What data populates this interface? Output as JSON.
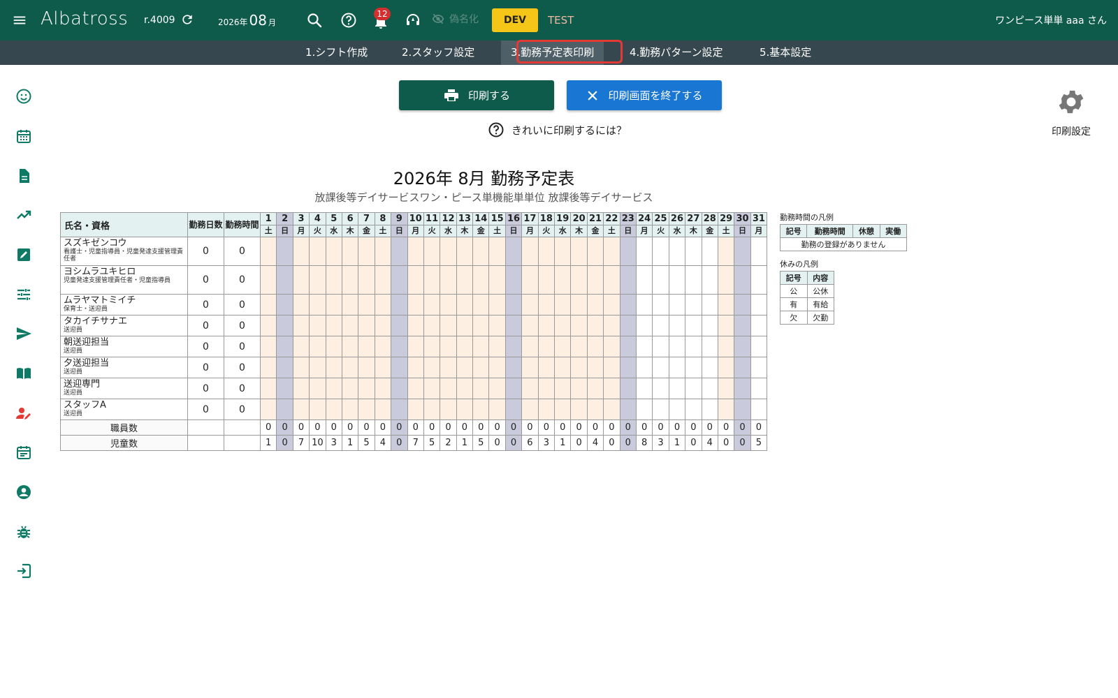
{
  "header": {
    "logo": "Albatross",
    "revision": "r.4009",
    "year_label": "2026年",
    "month": "08",
    "month_unit": "月",
    "notification_count": "12",
    "pseudonym_label": "偽名化",
    "dev_label": "DEV",
    "test_label": "TEST",
    "user": "ワンピース単単 aaa さん"
  },
  "tabs": [
    {
      "label": "1.シフト作成"
    },
    {
      "label": "2.スタッフ設定"
    },
    {
      "label": "3.勤務予定表印刷"
    },
    {
      "label": "4.勤務パターン設定"
    },
    {
      "label": "5.基本設定"
    }
  ],
  "actions": {
    "print": "印刷する",
    "close": "印刷画面を終了する",
    "help": "きれいに印刷するには？",
    "print_settings": "印刷設定"
  },
  "document": {
    "title": "2026年 8月 勤務予定表",
    "subtitle": "放課後等デイサービスワン・ピース単機能単単位 放課後等デイサービス"
  },
  "schedule": {
    "col_name": "氏名・資格",
    "col_days": "勤務日数",
    "col_hours": "勤務時間",
    "days": [
      "1",
      "2",
      "3",
      "4",
      "5",
      "6",
      "7",
      "8",
      "9",
      "10",
      "11",
      "12",
      "13",
      "14",
      "15",
      "16",
      "17",
      "18",
      "19",
      "20",
      "21",
      "22",
      "23",
      "24",
      "25",
      "26",
      "27",
      "28",
      "29",
      "30",
      "31"
    ],
    "weekdays": [
      "土",
      "日",
      "月",
      "火",
      "水",
      "木",
      "金",
      "土",
      "日",
      "月",
      "火",
      "水",
      "木",
      "金",
      "土",
      "日",
      "月",
      "火",
      "水",
      "木",
      "金",
      "土",
      "日",
      "月",
      "火",
      "水",
      "木",
      "金",
      "土",
      "日",
      "月"
    ],
    "staff": [
      {
        "name": "スズキゼンコウ",
        "qual": "看護士・児童指導員・児童発達支援管理責任者",
        "days": "0",
        "hours": "0"
      },
      {
        "name": "ヨシムラユキヒロ",
        "qual": "児童発達支援管理責任者・児童指導員",
        "days": "0",
        "hours": "0"
      },
      {
        "name": "ムラヤマトミイチ",
        "qual": "保育士・送迎員",
        "days": "0",
        "hours": "0"
      },
      {
        "name": "タカイチサナエ",
        "qual": "送迎員",
        "days": "0",
        "hours": "0"
      },
      {
        "name": "朝送迎担当",
        "qual": "送迎員",
        "days": "0",
        "hours": "0"
      },
      {
        "name": "夕送迎担当",
        "qual": "送迎員",
        "days": "0",
        "hours": "0"
      },
      {
        "name": "送迎専門",
        "qual": "送迎員",
        "days": "0",
        "hours": "0"
      },
      {
        "name": "スタッフA",
        "qual": "送迎員",
        "days": "0",
        "hours": "0"
      }
    ],
    "staff_count_label": "職員数",
    "staff_counts": [
      "0",
      "0",
      "0",
      "0",
      "0",
      "0",
      "0",
      "0",
      "0",
      "0",
      "0",
      "0",
      "0",
      "0",
      "0",
      "0",
      "0",
      "0",
      "0",
      "0",
      "0",
      "0",
      "0",
      "0",
      "0",
      "0",
      "0",
      "0",
      "0",
      "0",
      "0"
    ],
    "child_count_label": "児童数",
    "child_counts": [
      "1",
      "0",
      "7",
      "10",
      "3",
      "1",
      "5",
      "4",
      "0",
      "7",
      "5",
      "2",
      "1",
      "5",
      "0",
      "0",
      "6",
      "3",
      "1",
      "0",
      "4",
      "0",
      "0",
      "8",
      "3",
      "1",
      "0",
      "4",
      "0",
      "0",
      "5"
    ]
  },
  "legend_work": {
    "title": "勤務時間の凡例",
    "headers": [
      "記号",
      "勤務時間",
      "休憩",
      "実働"
    ],
    "empty": "勤務の登録がありません"
  },
  "legend_off": {
    "title": "休みの凡例",
    "headers": [
      "記号",
      "内容"
    ],
    "rows": [
      [
        "公",
        "公休"
      ],
      [
        "有",
        "有給"
      ],
      [
        "欠",
        "欠勤"
      ]
    ]
  },
  "colors": {
    "header_bg": "#0e5b4c",
    "tabbar_bg": "#37474f",
    "print_btn": "#0e5b4c",
    "close_btn": "#1976d2",
    "dev_badge": "#f5c518",
    "sunday_col": "#c9cbdc",
    "weekday_col": "#fdf0e2",
    "highlight": "#e53935"
  }
}
